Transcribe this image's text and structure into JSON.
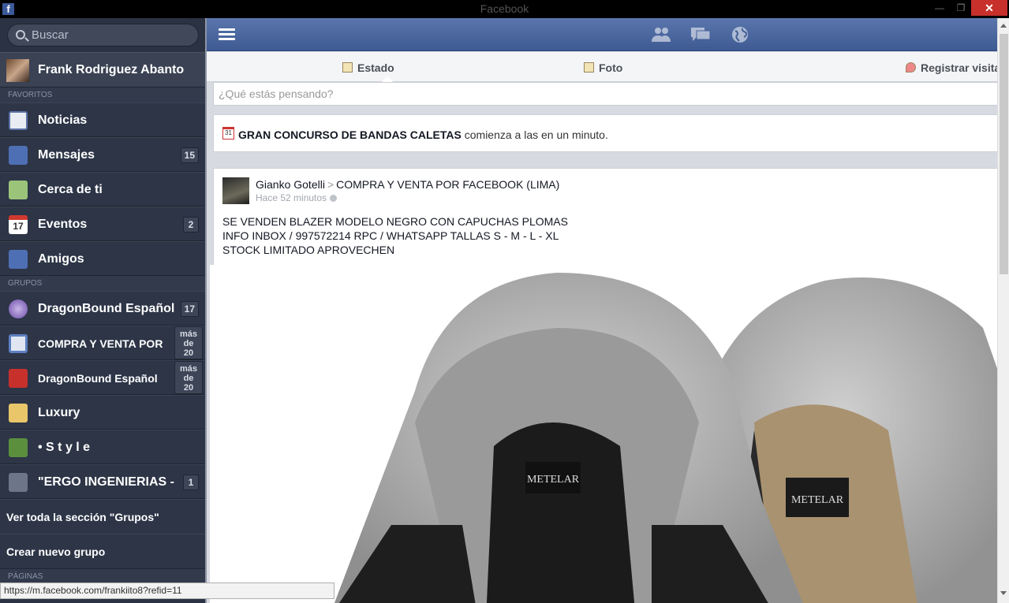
{
  "window": {
    "title": "Facebook",
    "close_glyph": "✕",
    "minimize_glyph": "—",
    "maximize_glyph": "❐"
  },
  "sidebar": {
    "search_placeholder": "Buscar",
    "profile_name": "Frank Rodriguez Abanto",
    "favorites_header": "FAVORITOS",
    "favorites": [
      {
        "label": "Noticias",
        "icon": "news-feed-icon",
        "count": ""
      },
      {
        "label": "Mensajes",
        "icon": "messages-icon",
        "count": "15"
      },
      {
        "label": "Cerca de ti",
        "icon": "nearby-icon",
        "count": ""
      },
      {
        "label": "Eventos",
        "icon": "events-icon",
        "count": "2"
      },
      {
        "label": "Amigos",
        "icon": "friends-icon",
        "count": ""
      }
    ],
    "groups_header": "GRUPOS",
    "groups": [
      {
        "label": "DragonBound Español",
        "icon": "group-icon",
        "count": "17"
      },
      {
        "label": "COMPRA Y VENTA POR",
        "icon": "laptop-icon",
        "count": "más de 20"
      },
      {
        "label": "DragonBound Español",
        "icon": "group-icon",
        "count": "más de 20"
      },
      {
        "label": "Luxury",
        "icon": "gavel-icon",
        "count": ""
      },
      {
        "label": "• S t y l e",
        "icon": "dice-icon",
        "count": ""
      },
      {
        "label": "\"ERGO INGENIERIAS -",
        "icon": "fist-icon",
        "count": "1"
      }
    ],
    "see_all_groups": "Ver toda la sección \"Grupos\"",
    "create_group": "Crear nuevo grupo",
    "pages_header": "PÁGINAS"
  },
  "composer": {
    "tabs": [
      {
        "label": "Estado",
        "icon": "status-icon"
      },
      {
        "label": "Foto",
        "icon": "photo-icon"
      },
      {
        "label": "Registrar visita",
        "icon": "checkin-icon"
      }
    ],
    "placeholder": "¿Qué estás pensando?"
  },
  "event_notice": {
    "title": "GRAN CONCURSO DE BANDAS CALETAS",
    "suffix": " comienza a las en un minuto.",
    "icon_day": "31"
  },
  "post": {
    "author": "Gianko Gotelli",
    "separator": ">",
    "group": "COMPRA Y VENTA POR FACEBOOK (LIMA)",
    "time": "Hace 52 minutos",
    "lines": [
      "SE VENDEN BLAZER MODELO NEGRO CON CAPUCHAS PLOMAS",
      "INFO INBOX / 997572214 RPC / WHATSAPP TALLAS S - M - L - XL",
      "STOCK LIMITADO APROVECHEN"
    ],
    "label_text": "METELAR"
  },
  "status_url": "https://m.facebook.com/frankiito8?refid=11",
  "colors": {
    "sidebar": "#2a3244",
    "topbar": "#3e5a92",
    "close": "#c7302b"
  }
}
